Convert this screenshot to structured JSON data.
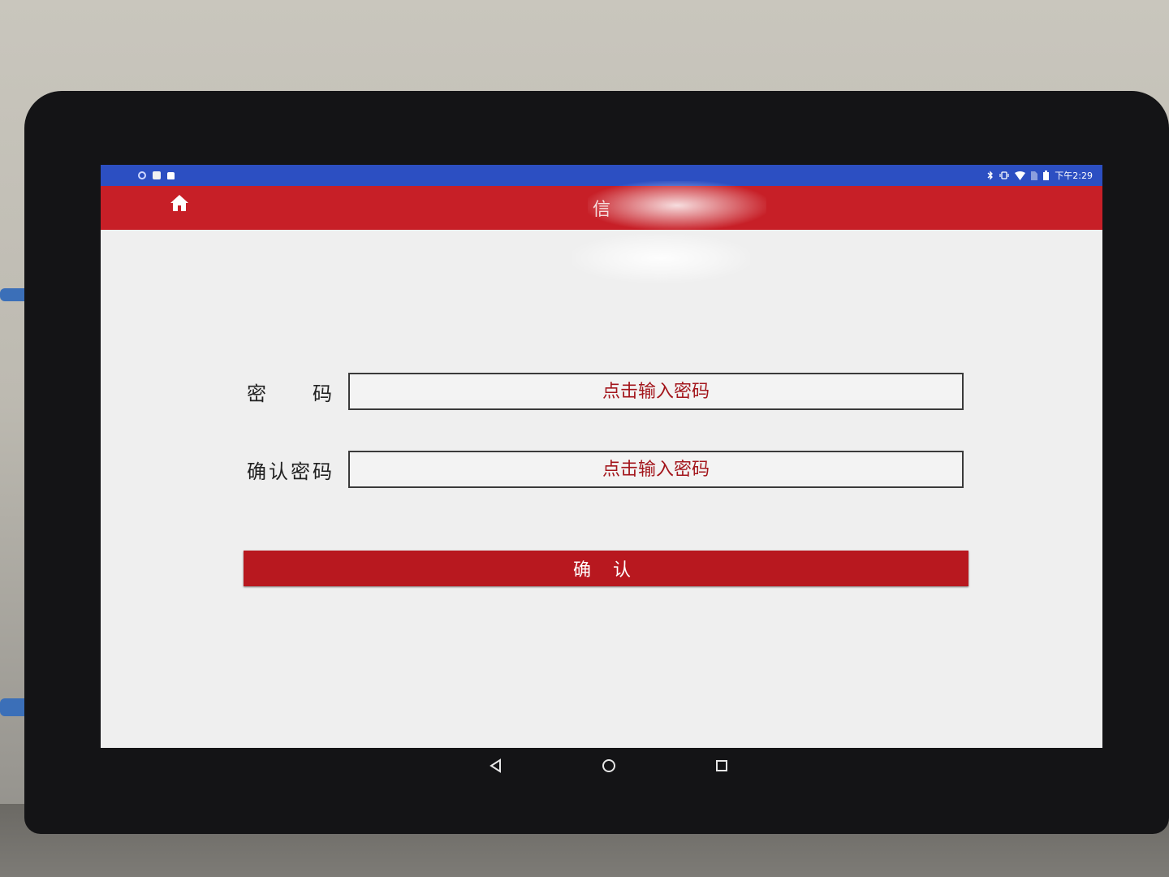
{
  "status_bar": {
    "time": "下午2:29"
  },
  "title_bar": {
    "title": "信"
  },
  "form": {
    "password_label": "密 码",
    "password_placeholder": "点击输入密码",
    "confirm_password_label": "确认密码",
    "confirm_password_placeholder": "点击输入密码",
    "confirm_button_label": "确 认"
  },
  "colors": {
    "status_bar": "#2c4fc2",
    "title_bar": "#c71f27",
    "accent": "#b8181f",
    "placeholder_text": "#a3161c",
    "screen_bg": "#efefef"
  },
  "icons": {
    "home": "home-icon",
    "back": "back-triangle-icon",
    "home_nav": "circle-home-icon",
    "recents": "square-recents-icon"
  }
}
